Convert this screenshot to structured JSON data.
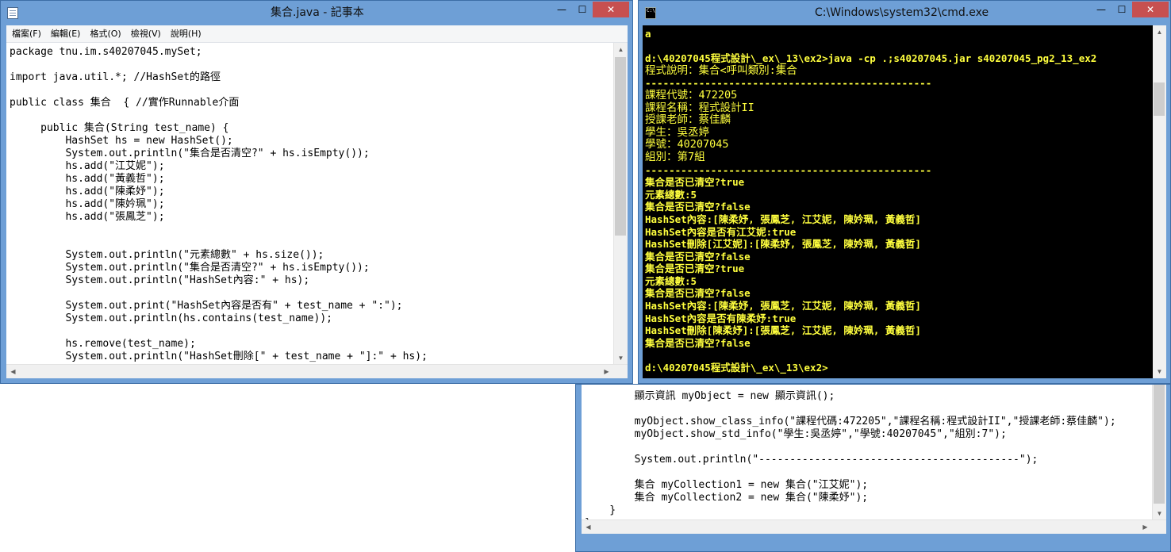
{
  "notepad": {
    "title": "集合.java - 記事本",
    "min_glyph": "—",
    "max_glyph": "☐",
    "close_glyph": "✕",
    "menu": [
      "檔案(F)",
      "編輯(E)",
      "格式(O)",
      "檢視(V)",
      "說明(H)"
    ],
    "code": "package tnu.im.s40207045.mySet;\n\nimport java.util.*; //HashSet的路徑\n\npublic class 集合  { //實作Runnable介面\n\n     public 集合(String test_name) {\n         HashSet hs = new HashSet();\n         System.out.println(\"集合是否清空?\" + hs.isEmpty());\n         hs.add(\"江艾妮\");\n         hs.add(\"黃義哲\");\n         hs.add(\"陳柔妤\");\n         hs.add(\"陳妗珮\");\n         hs.add(\"張鳳芝\");\n\n\n         System.out.println(\"元素總數\" + hs.size());\n         System.out.println(\"集合是否清空?\" + hs.isEmpty());\n         System.out.println(\"HashSet內容:\" + hs);\n\n         System.out.print(\"HashSet內容是否有\" + test_name + \":\");\n         System.out.println(hs.contains(test_name));\n\n         hs.remove(test_name);\n         System.out.println(\"HashSet刪除[\" + test_name + \"]:\" + hs);"
  },
  "cmd": {
    "title": "C:\\Windows\\system32\\cmd.exe",
    "min_glyph": "—",
    "max_glyph": "☐",
    "close_glyph": "✕",
    "lines": [
      {
        "text": "a",
        "big": false
      },
      {
        "text": "",
        "big": false
      },
      {
        "text": "d:\\40207045程式設計\\_ex\\_13\\ex2>java -cp .;s40207045.jar s40207045_pg2_13_ex2",
        "big": false
      },
      {
        "text": "程式說明：集合<呼叫類別:集合",
        "big": true
      },
      {
        "text": "------------------------------------------------",
        "big": false
      },
      {
        "text": "課程代號：472205",
        "big": true
      },
      {
        "text": "課程名稱：程式設計II",
        "big": true
      },
      {
        "text": "授課老師：蔡佳麟",
        "big": true
      },
      {
        "text": "學生：吳丞婷",
        "big": true
      },
      {
        "text": "學號：40207045",
        "big": true
      },
      {
        "text": "組別：第7組",
        "big": true
      },
      {
        "text": "------------------------------------------------",
        "big": false
      },
      {
        "text": "集合是否已清空?true",
        "big": false
      },
      {
        "text": "元素總數:5",
        "big": false
      },
      {
        "text": "集合是否已清空?false",
        "big": false
      },
      {
        "text": "HashSet內容:[陳柔妤, 張鳳芝, 江艾妮, 陳妗珮, 黃義哲]",
        "big": false
      },
      {
        "text": "HashSet內容是否有江艾妮:true",
        "big": false
      },
      {
        "text": "HashSet刪除[江艾妮]:[陳柔妤, 張鳳芝, 陳妗珮, 黃義哲]",
        "big": false
      },
      {
        "text": "集合是否已清空?false",
        "big": false
      },
      {
        "text": "集合是否已清空?true",
        "big": false
      },
      {
        "text": "元素總數:5",
        "big": false
      },
      {
        "text": "集合是否已清空?false",
        "big": false
      },
      {
        "text": "HashSet內容:[陳柔妤, 張鳳芝, 江艾妮, 陳妗珮, 黃義哲]",
        "big": false
      },
      {
        "text": "HashSet內容是否有陳柔妤:true",
        "big": false
      },
      {
        "text": "HashSet刪除[陳柔妤]:[張鳳芝, 江艾妮, 陳妗珮, 黃義哲]",
        "big": false
      },
      {
        "text": "集合是否已清空?false",
        "big": false
      },
      {
        "text": "",
        "big": false
      },
      {
        "text": "d:\\40207045程式設計\\_ex\\_13\\ex2>",
        "big": false
      }
    ]
  },
  "notepad2": {
    "code": "        顯示資訊 myObject = new 顯示資訊();\n\n        myObject.show_class_info(\"課程代碼:472205\",\"課程名稱:程式設計II\",\"授課老師:蔡佳麟\");\n        myObject.show_std_info(\"學生:吳丞婷\",\"學號:40207045\",\"組別:7\");\n\n        System.out.println(\"------------------------------------------\");\n\n        集合 myCollection1 = new 集合(\"江艾妮\");\n        集合 myCollection2 = new 集合(\"陳柔妤\");\n    }\n}"
  }
}
